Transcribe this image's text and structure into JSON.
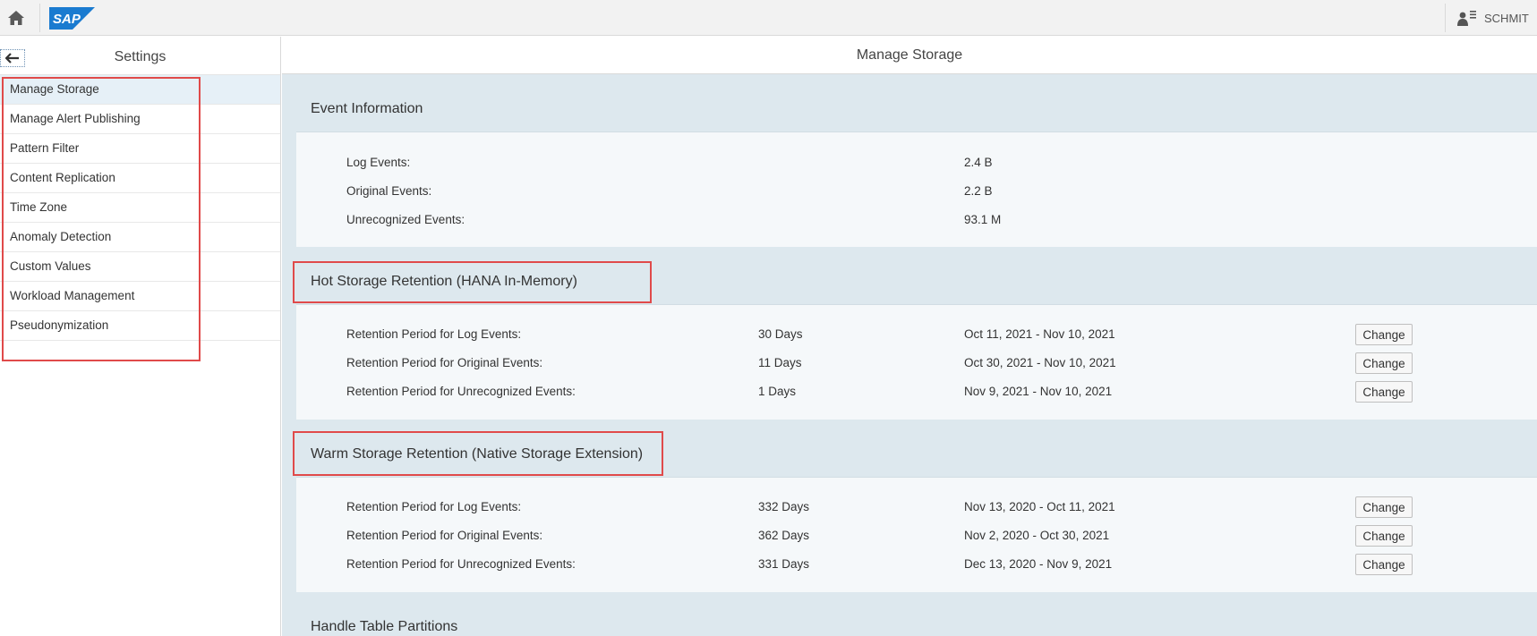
{
  "shell": {
    "user_name": "SCHMIT"
  },
  "sidebar": {
    "title": "Settings",
    "items": [
      {
        "label": "Manage Storage"
      },
      {
        "label": "Manage Alert Publishing"
      },
      {
        "label": "Pattern Filter"
      },
      {
        "label": "Content Replication"
      },
      {
        "label": "Time Zone"
      },
      {
        "label": "Anomaly Detection"
      },
      {
        "label": "Custom Values"
      },
      {
        "label": "Workload Management"
      },
      {
        "label": "Pseudonymization"
      }
    ]
  },
  "main": {
    "title": "Manage Storage",
    "event_info": {
      "title": "Event Information",
      "rows": [
        {
          "label": "Log Events:",
          "value": "2.4 B"
        },
        {
          "label": "Original Events:",
          "value": "2.2 B"
        },
        {
          "label": "Unrecognized Events:",
          "value": "93.1 M"
        }
      ]
    },
    "hot": {
      "title": "Hot Storage Retention (HANA In-Memory)",
      "rows": [
        {
          "label": "Retention Period for Log Events:",
          "days": "30 Days",
          "range": "Oct 11, 2021  - Nov 10, 2021",
          "button": "Change"
        },
        {
          "label": "Retention Period for Original Events:",
          "days": "11 Days",
          "range": "Oct 30, 2021  - Nov 10, 2021",
          "button": "Change"
        },
        {
          "label": "Retention Period for Unrecognized Events:",
          "days": "1 Days",
          "range": "Nov 9, 2021  - Nov 10, 2021",
          "button": "Change"
        }
      ]
    },
    "warm": {
      "title": "Warm Storage Retention (Native Storage Extension)",
      "rows": [
        {
          "label": "Retention Period for Log Events:",
          "days": "332 Days",
          "range": "Nov 13, 2020  - Oct 11, 2021",
          "button": "Change"
        },
        {
          "label": "Retention Period for Original Events:",
          "days": "362 Days",
          "range": "Nov 2, 2020  - Oct 30, 2021",
          "button": "Change"
        },
        {
          "label": "Retention Period for Unrecognized Events:",
          "days": "331 Days",
          "range": "Dec 13, 2020  - Nov 9, 2021",
          "button": "Change"
        }
      ]
    },
    "partitions": {
      "title": "Handle Table Partitions"
    }
  },
  "colors": {
    "highlight": "#e04a4a",
    "sap_blue": "#1673c6",
    "active_item": "#e6f0f7"
  },
  "icons": [
    "home-icon",
    "sap-logo",
    "user-icon",
    "back-arrow-icon"
  ]
}
